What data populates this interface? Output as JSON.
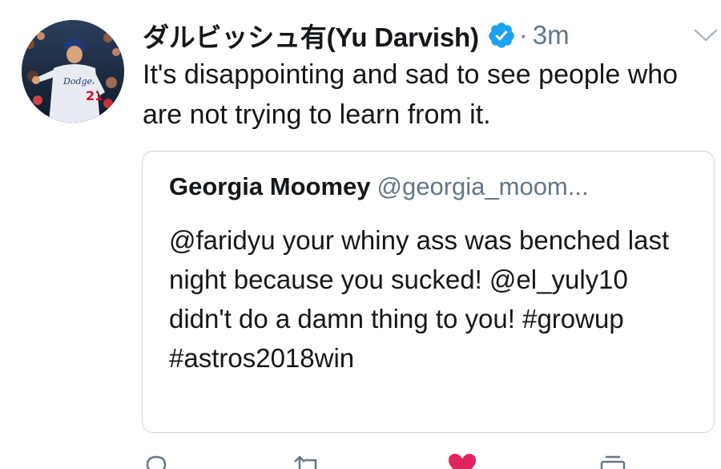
{
  "tweet": {
    "display_name": "ダルビッシュ有(Yu Darvish)",
    "verified_icon": "verified-badge-icon",
    "separator": "·",
    "time": "3m",
    "menu_icon": "chevron-down-icon",
    "text": "It's disappointing and sad to see people who are not trying to learn from it.",
    "avatar_icon": "baseball-player-avatar"
  },
  "quoted_tweet": {
    "name": "Georgia Moomey",
    "handle": "@georgia_moom...",
    "text": "@faridyu your whiny ass was benched last night because you sucked! @el_yuly10 didn't do a damn thing to you! #growup #astros2018win"
  },
  "actions": {
    "reply_icon": "reply-icon",
    "retweet_icon": "retweet-icon",
    "like_icon": "heart-icon",
    "share_icon": "share-icon"
  },
  "colors": {
    "text": "#14171a",
    "muted": "#657786",
    "verified": "#1da1f2",
    "like": "#e0245e",
    "border": "#ccd6dd"
  }
}
